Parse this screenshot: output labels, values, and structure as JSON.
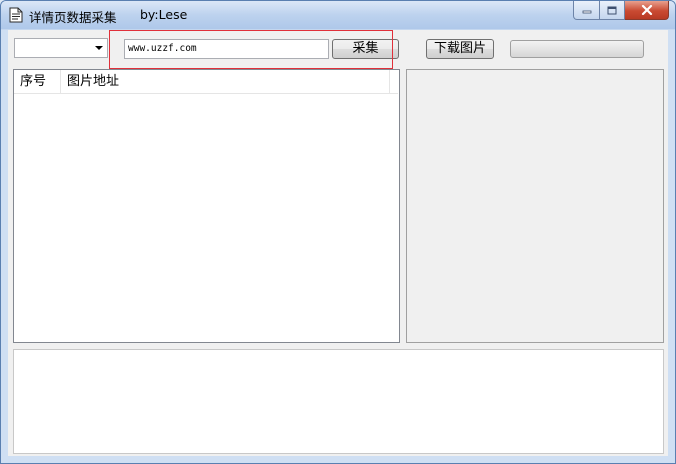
{
  "window": {
    "title": "详情页数据采集",
    "author": "by:Lese",
    "controls": {
      "minimize": "minimize-icon",
      "maximize": "maximize-icon",
      "close": "close-icon"
    }
  },
  "toolbar": {
    "combo_value": "",
    "url_value": "www.uzzf.com",
    "collect_label": "采集",
    "download_label": "下载图片",
    "progress": 0
  },
  "list": {
    "columns": [
      "序号",
      "图片地址"
    ],
    "rows": []
  },
  "colors": {
    "highlight": "#e0303a",
    "close_button": "#c94a32"
  }
}
